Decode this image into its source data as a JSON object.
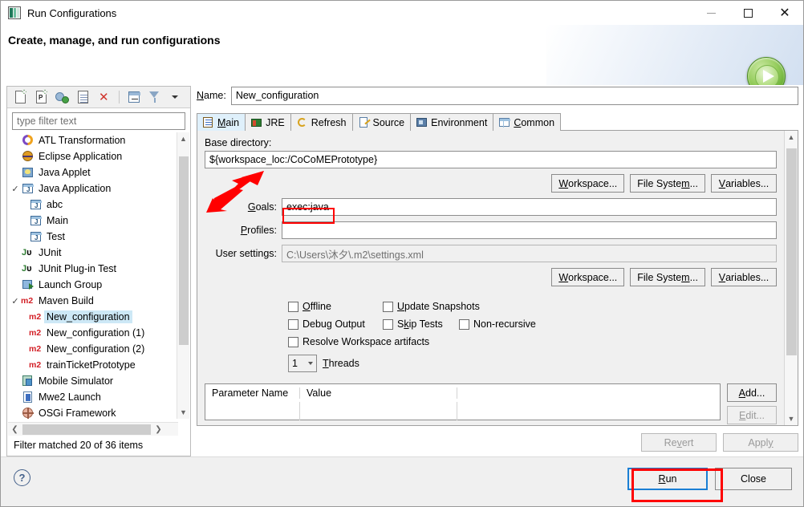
{
  "window": {
    "title": "Run Configurations",
    "title_icon": "run-configurations-icon",
    "minimize": "minimize-icon",
    "maximize": "maximize-icon",
    "close": "close-icon"
  },
  "header": {
    "title": "Create, manage, and run configurations",
    "badge_icon": "green-run-play-icon"
  },
  "left_panel": {
    "toolbar": [
      {
        "name": "new-configuration-icon",
        "title": "New launch configuration"
      },
      {
        "name": "new-prototype-icon",
        "title": "New prototype"
      },
      {
        "name": "export-icon",
        "title": "Export"
      },
      {
        "name": "duplicate-icon",
        "title": "Duplicate"
      },
      {
        "name": "delete-icon",
        "title": "Delete"
      },
      {
        "name": "collapse-all-icon",
        "title": "Collapse All"
      },
      {
        "name": "filter-icon",
        "title": "Filter launch configurations"
      },
      {
        "name": "view-menu-icon",
        "title": "View Menu"
      }
    ],
    "filter": {
      "placeholder": "type filter text",
      "value": ""
    },
    "tree": [
      {
        "label": "ATL Transformation",
        "icon": "atl-icon",
        "indent": 0,
        "expander": "",
        "selected": false
      },
      {
        "label": "Eclipse Application",
        "icon": "eclipse-icon",
        "indent": 0,
        "expander": "",
        "selected": false
      },
      {
        "label": "Java Applet",
        "icon": "java-applet-icon",
        "indent": 0,
        "expander": "",
        "selected": false
      },
      {
        "label": "Java Application",
        "icon": "java-application-icon",
        "indent": 0,
        "expander": "⌄",
        "selected": false
      },
      {
        "label": "abc",
        "icon": "java-config-icon",
        "indent": 1,
        "expander": "",
        "selected": false
      },
      {
        "label": "Main",
        "icon": "java-config-icon",
        "indent": 1,
        "expander": "",
        "selected": false
      },
      {
        "label": "Test",
        "icon": "java-config-icon",
        "indent": 1,
        "expander": "",
        "selected": false
      },
      {
        "label": "JUnit",
        "icon": "junit-icon",
        "indent": 0,
        "expander": "",
        "selected": false
      },
      {
        "label": "JUnit Plug-in Test",
        "icon": "junit-plugin-icon",
        "indent": 0,
        "expander": "",
        "selected": false
      },
      {
        "label": "Launch Group",
        "icon": "launch-group-icon",
        "indent": 0,
        "expander": "",
        "selected": false
      },
      {
        "label": "Maven Build",
        "icon": "maven-icon",
        "indent": 0,
        "expander": "⌄",
        "selected": false
      },
      {
        "label": "New_configuration",
        "icon": "maven-icon",
        "indent": 1,
        "expander": "",
        "selected": true
      },
      {
        "label": "New_configuration (1)",
        "icon": "maven-icon",
        "indent": 1,
        "expander": "",
        "selected": false
      },
      {
        "label": "New_configuration (2)",
        "icon": "maven-icon",
        "indent": 1,
        "expander": "",
        "selected": false
      },
      {
        "label": "trainTicketPrototype",
        "icon": "maven-icon",
        "indent": 1,
        "expander": "",
        "selected": false
      },
      {
        "label": "Mobile Simulator",
        "icon": "mobile-simulator-icon",
        "indent": 0,
        "expander": "",
        "selected": false
      },
      {
        "label": "Mwe2 Launch",
        "icon": "mwe2-icon",
        "indent": 0,
        "expander": "",
        "selected": false
      },
      {
        "label": "OSGi Framework",
        "icon": "osgi-icon",
        "indent": 0,
        "expander": "",
        "selected": false
      }
    ],
    "status": "Filter matched 20 of 36 items"
  },
  "right_panel": {
    "name_label": "Name:",
    "name_label_accel": "N",
    "name_value": "New_configuration",
    "tabs": [
      {
        "label": "Main",
        "icon": "main-tab-icon",
        "active": true
      },
      {
        "label": "JRE",
        "icon": "jre-tab-icon",
        "active": false
      },
      {
        "label": "Refresh",
        "icon": "refresh-tab-icon",
        "active": false
      },
      {
        "label": "Source",
        "icon": "source-tab-icon",
        "active": false
      },
      {
        "label": "Environment",
        "icon": "environment-tab-icon",
        "active": false
      },
      {
        "label": "Common",
        "icon": "common-tab-icon",
        "active": false
      }
    ],
    "base_directory": {
      "label": "Base directory:",
      "value": "${workspace_loc:/CoCoMEPrototype}",
      "buttons": [
        "Workspace...",
        "File System...",
        "Variables..."
      ]
    },
    "goals": {
      "label": "Goals:",
      "accel": "G",
      "value": "exec:java"
    },
    "profiles": {
      "label": "Profiles:",
      "accel": "P",
      "value": ""
    },
    "user_settings": {
      "label": "User settings:",
      "value": "C:\\Users\\沐夕\\.m2\\settings.xml",
      "buttons": [
        "Workspace...",
        "File System...",
        "Variables..."
      ]
    },
    "checkboxes": [
      {
        "label": "Offline",
        "accel": "O",
        "checked": false
      },
      {
        "label": "Update Snapshots",
        "accel": "U",
        "checked": false
      },
      {
        "label": "Debug Output",
        "accel": "g",
        "checked": false
      },
      {
        "label": "Skip Tests",
        "accel": "k",
        "checked": false
      },
      {
        "label": "Non-recursive",
        "accel": "",
        "checked": false
      },
      {
        "label": "Resolve Workspace artifacts",
        "accel": "",
        "checked": false
      }
    ],
    "threads": {
      "value": "1",
      "label": "Threads",
      "accel": "T"
    },
    "parameters_table": {
      "columns": [
        "Parameter Name",
        "Value"
      ],
      "rows": [],
      "buttons": [
        "Add...",
        "Edit..."
      ]
    },
    "revert_label": "Revert",
    "revert_accel": "v",
    "apply_label": "Apply",
    "apply_accel": "y"
  },
  "footer": {
    "help_icon": "help-icon",
    "help_glyph": "?",
    "run_label": "Run",
    "run_accel": "R",
    "close_label": "Close"
  },
  "annotations": {
    "goals_highlight": "red-rect-around-goals-field",
    "run_highlight": "red-rect-around-run-button",
    "base_directory_arrow": "red-arrow-pointing-to-base-directory"
  },
  "colors": {
    "accent_blue": "#1a7fd4",
    "annotation_red": "#ff0000",
    "selection_blue": "#cde8f6",
    "maven_red": "#d31f26",
    "run_green": "#63ab2e"
  }
}
